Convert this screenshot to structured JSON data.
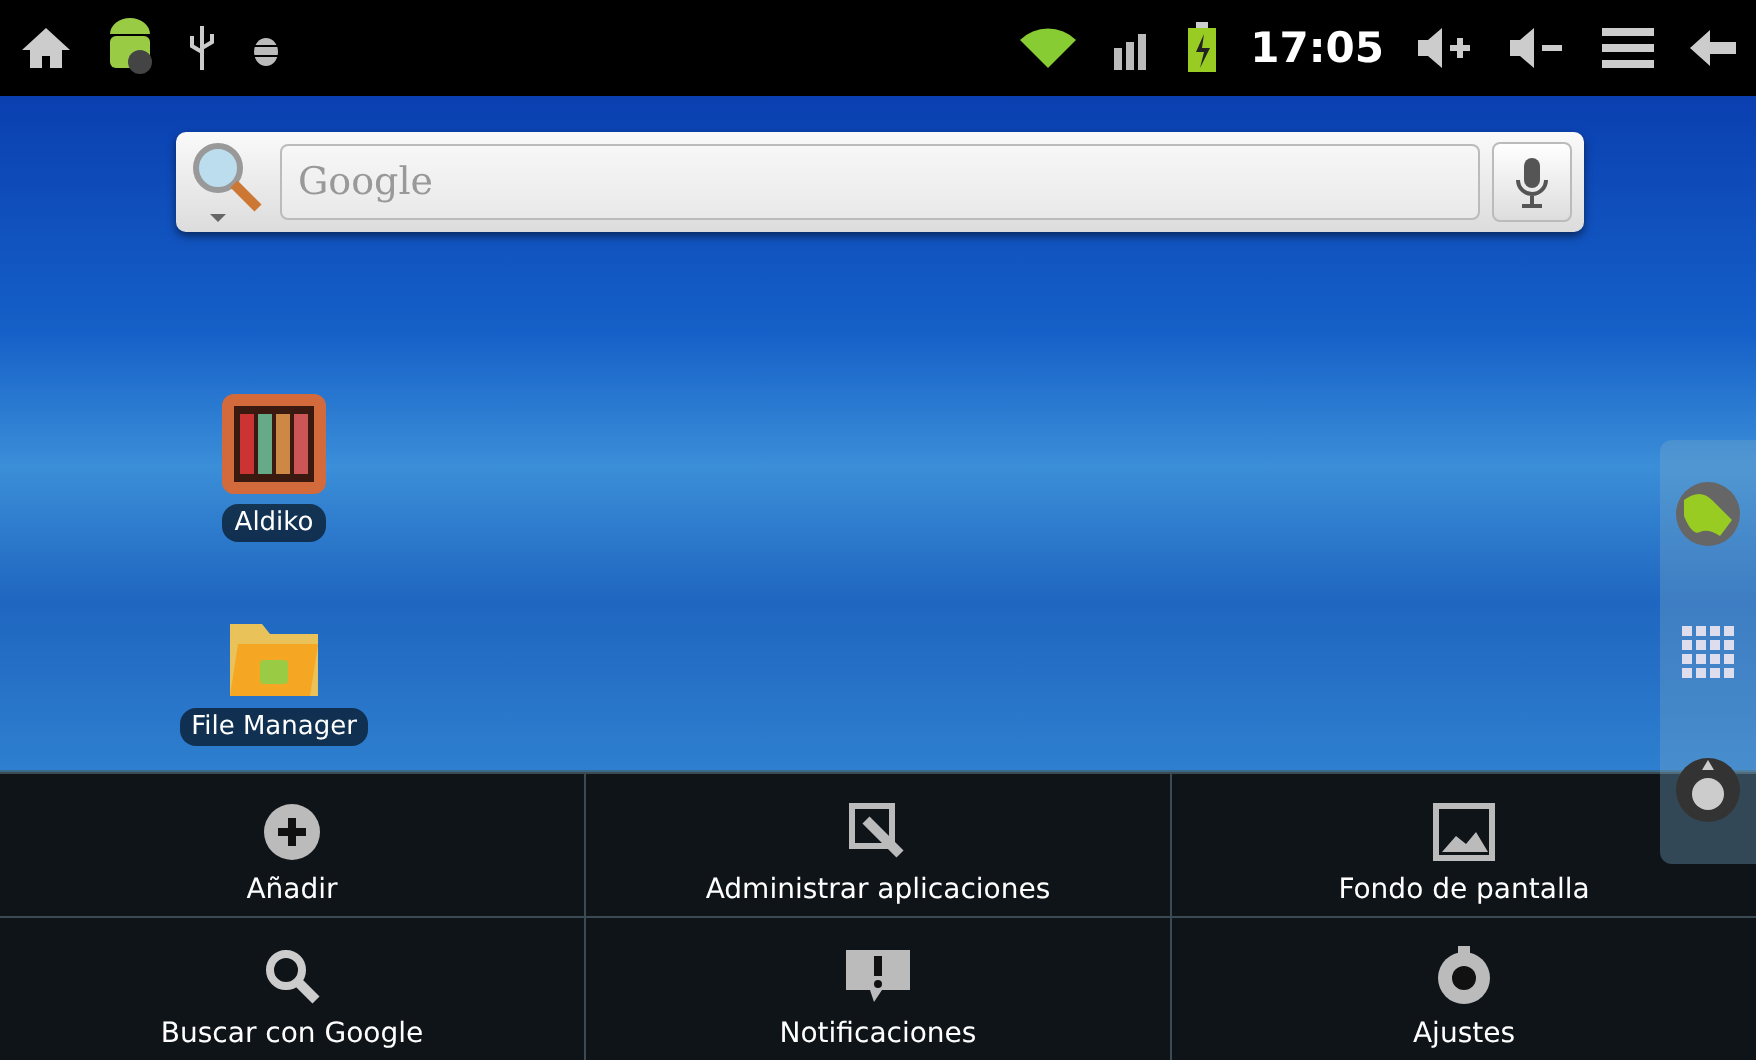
{
  "status_bar": {
    "time": "17:05"
  },
  "search": {
    "placeholder": "Google"
  },
  "desktop_icons": [
    {
      "label": "Aldiko",
      "kind": "books"
    },
    {
      "label": "File Manager",
      "kind": "folder"
    }
  ],
  "menu": [
    {
      "label": "Añadir",
      "kind": "add"
    },
    {
      "label": "Administrar aplicaciones",
      "kind": "manage"
    },
    {
      "label": "Fondo de pantalla",
      "kind": "wallpaper"
    },
    {
      "label": "Buscar con Google",
      "kind": "search"
    },
    {
      "label": "Notificaciones",
      "kind": "notifications"
    },
    {
      "label": "Ajustes",
      "kind": "settings"
    }
  ]
}
